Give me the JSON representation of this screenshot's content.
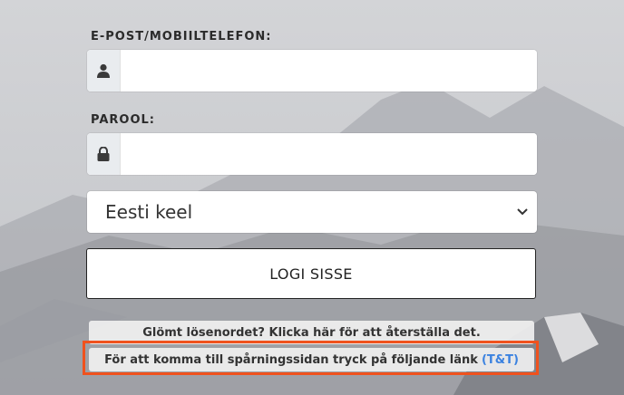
{
  "form": {
    "email_label": "E-POST/MOBIILTELEFON:",
    "email_value": "",
    "password_label": "PAROOL:",
    "password_value": "",
    "language_selected": "Eesti keel",
    "login_button": "LOGI SISSE"
  },
  "links": {
    "forgot_password": "Glömt lösenordet? Klicka här för att återställa det.",
    "tracking_text": "För att komma till spårningssidan tryck på följande länk",
    "tracking_link": "(T&T)"
  },
  "icons": {
    "email_field": "user-icon",
    "password_field": "lock-icon",
    "language_select": "chevron-down-icon"
  },
  "colors": {
    "highlight_border": "#f0521e",
    "link_accent": "#3b82e0"
  }
}
